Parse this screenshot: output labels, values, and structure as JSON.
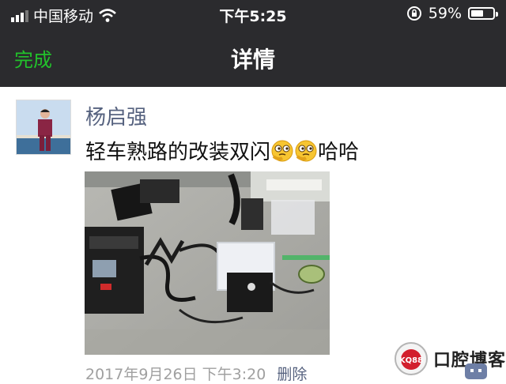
{
  "status_bar": {
    "carrier": "中国移动",
    "time": "下午5:25",
    "battery_percent": "59%",
    "battery_level": 0.59,
    "icons": [
      "signal-bars-icon",
      "wifi-icon",
      "rotation-lock-icon",
      "battery-icon"
    ]
  },
  "nav": {
    "done_label": "完成",
    "title": "详情"
  },
  "post": {
    "username": "杨启强",
    "text_before_emoji": "轻车熟路的改装双闪",
    "text_after_emoji": "哈哈",
    "emoji_count": 2,
    "emoji_name": "thinking-face-emoji",
    "timestamp": "2017年9月26日 下午3:20",
    "delete_label": "删除"
  },
  "watermark": {
    "badge_text": "KQ88",
    "site_name": "口腔博客"
  },
  "colors": {
    "header_bg": "#2b2b2e",
    "done_green": "#22c22b",
    "link_blue": "#56627f",
    "meta_gray": "#a0a0a0"
  }
}
